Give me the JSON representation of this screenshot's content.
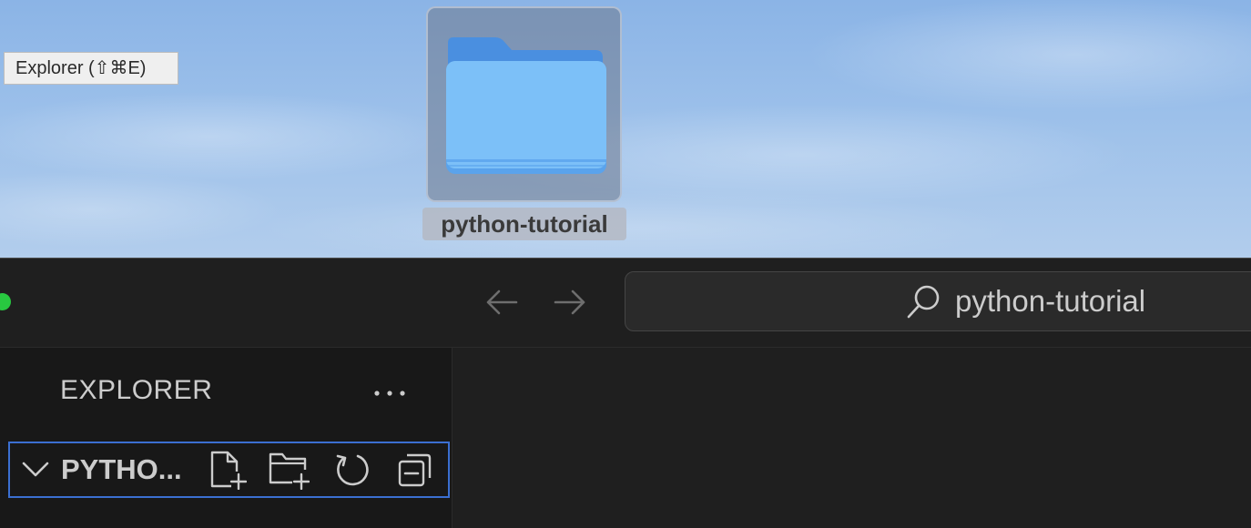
{
  "desktop": {
    "tooltip": "Explorer (⇧⌘E)",
    "folder": {
      "label": "python-tutorial",
      "icon": "folder-icon"
    }
  },
  "titlebar": {
    "back_icon": "arrow-left-icon",
    "forward_icon": "arrow-right-icon",
    "search_icon": "search-icon",
    "search_text": "python-tutorial"
  },
  "sidebar": {
    "title": "EXPLORER",
    "more_icon": "ellipsis-icon",
    "section": {
      "title": "PYTHO...",
      "chevron_icon": "chevron-down-icon",
      "actions": [
        {
          "name": "new-file",
          "icon": "new-file-icon"
        },
        {
          "name": "new-folder",
          "icon": "new-folder-icon"
        },
        {
          "name": "refresh",
          "icon": "refresh-icon"
        },
        {
          "name": "collapse-all",
          "icon": "collapse-all-icon"
        }
      ]
    }
  },
  "colors": {
    "accent_focus": "#3b6fd1",
    "window_bg": "#1f1f1f",
    "sidebar_bg": "#181818",
    "foreground": "#cccccc",
    "traffic_green": "#28c840",
    "folder_blue": "#7cc0f8"
  }
}
